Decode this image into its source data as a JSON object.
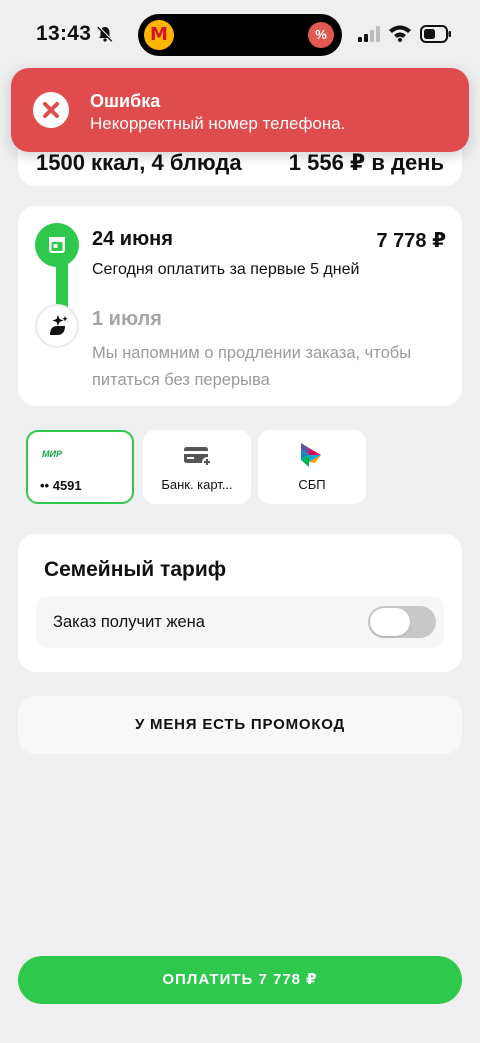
{
  "status_bar": {
    "time": "13:43",
    "island_logo": "М",
    "island_badge": "%"
  },
  "toast": {
    "title": "Ошибка",
    "message": "Некорректный номер телефона."
  },
  "summary": {
    "kcal": "1500 ккал, 4 блюда",
    "price": "1 556 ₽ в день"
  },
  "schedule": {
    "first": {
      "date": "24 июня",
      "price": "7 778 ₽",
      "description": "Сегодня оплатить за первые 5 дней"
    },
    "second": {
      "date": "1 июля",
      "description": "Мы напомним о продлении заказа, чтобы питаться без перерыва"
    }
  },
  "payment_methods": {
    "mir": {
      "logo": "МИР",
      "number": "•• 4591",
      "selected": true
    },
    "bank_card": {
      "label": "Банк. карт..."
    },
    "sbp": {
      "label": "СБП"
    }
  },
  "family": {
    "title": "Семейный тариф",
    "row_label": "Заказ получит жена",
    "toggle_on": false
  },
  "promo": {
    "label": "У МЕНЯ ЕСТЬ ПРОМОКОД"
  },
  "pay": {
    "label": "ОПЛАТИТЬ 7 778 ₽"
  },
  "colors": {
    "accent_green": "#2ec84d",
    "error_red": "#e04b4d",
    "background": "#efefef"
  },
  "icons": [
    "bell-slash-icon",
    "signal-icon",
    "wifi-icon",
    "battery-icon",
    "close-icon",
    "calendar-icon",
    "sparkle-icon",
    "card-add-icon",
    "sbp-logo-icon"
  ]
}
